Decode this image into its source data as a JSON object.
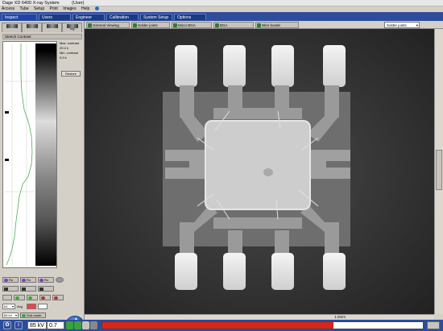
{
  "window": {
    "title": "Dage XD 6400 X-ray System",
    "user": "(User)"
  },
  "menu": [
    "Access",
    "Tube",
    "Setup",
    "Print",
    "Images",
    "Help"
  ],
  "main_tabs": [
    "Inspect",
    "Users",
    "Engineer",
    "Calibration",
    "System Setup",
    "Options"
  ],
  "left_panel": {
    "tool_tabs": [
      "",
      "",
      "",
      "Stg"
    ],
    "title": "Stretch Contrast",
    "stats": {
      "max_label": "Max. contrast",
      "max_value": "29.4 k",
      "min_label": "Min. contrast",
      "min_value": "5.9 k"
    },
    "restore_label": "Restore",
    "histogram_level": 0.52
  },
  "controls": {
    "lamp_labels": [
      "Ro",
      "Ro",
      "Ro"
    ],
    "box_labels": [
      "",
      "",
      ""
    ],
    "frame_avg_value": "64",
    "avg_label": "Avg",
    "kv_value": "85 kV",
    "sub_mode_label": "Sub-mode",
    "power_label": "Power"
  },
  "view_tabs": [
    "General Viewing",
    "Solder joints",
    "Micro BGA",
    "BGA",
    "Wire bonds"
  ],
  "view_select": "Solder joints",
  "scale_label": "1.0mm",
  "status": {
    "kv": "85 kV",
    "watts": "0.7 W",
    "progress": 0.72
  },
  "colors": {
    "title_blue": "#2d4d9c",
    "progress_red": "#d7261c",
    "globe_blue": "#2b6cc4"
  }
}
